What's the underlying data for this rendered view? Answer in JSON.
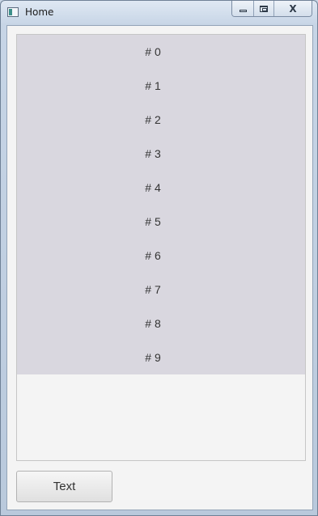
{
  "window": {
    "title": "Home",
    "close_glyph": "X"
  },
  "list": {
    "items": [
      "# 0",
      "# 1",
      "# 2",
      "# 3",
      "# 4",
      "# 5",
      "# 6",
      "# 7",
      "# 8",
      "# 9"
    ]
  },
  "button": {
    "label": "Text"
  },
  "icons": {
    "app": "app-window-icon",
    "minimize": "minimize-icon",
    "maximize": "maximize-icon",
    "close": "close-icon"
  }
}
